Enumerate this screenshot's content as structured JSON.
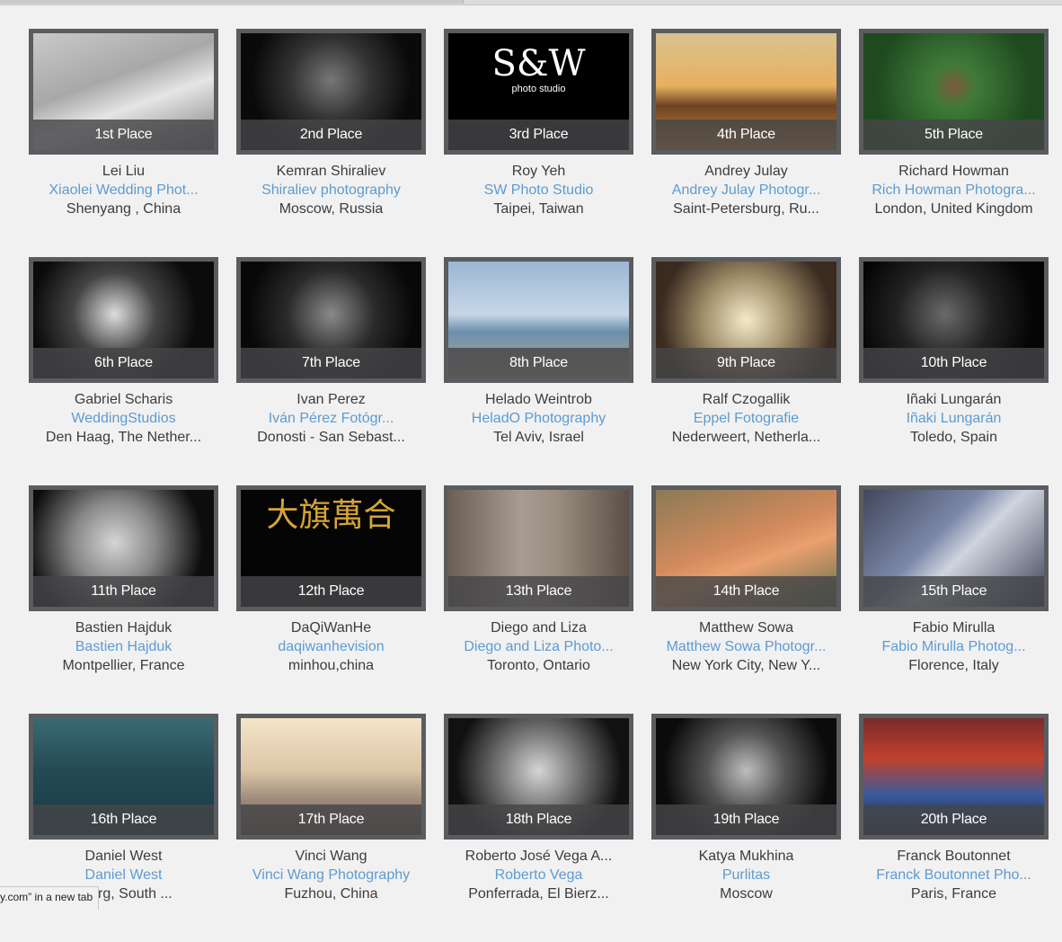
{
  "colors": {
    "link": "#5d9bd1",
    "text": "#3c3c3c",
    "background": "#f1f1f1",
    "frame": "#5a5c60"
  },
  "logos": {
    "third_place_logo": {
      "main": "S&W",
      "sub": "photo studio"
    },
    "twelfth_place_logo": {
      "text": "大旗萬合"
    }
  },
  "status_tooltip": "y.com” in a new tab",
  "entries": [
    {
      "place": "1st Place",
      "name": "Lei Liu",
      "studio": "Xiaolei Wedding Phot...",
      "location": "Shenyang , China"
    },
    {
      "place": "2nd Place",
      "name": "Kemran Shiraliev",
      "studio": "Shiraliev photography",
      "location": "Moscow, Russia"
    },
    {
      "place": "3rd Place",
      "name": "Roy Yeh",
      "studio": "SW Photo Studio",
      "location": "Taipei, Taiwan"
    },
    {
      "place": "4th Place",
      "name": "Andrey Julay",
      "studio": "Andrey Julay Photogr...",
      "location": "Saint-Petersburg, Ru..."
    },
    {
      "place": "5th Place",
      "name": "Richard Howman",
      "studio": "Rich Howman Photogra...",
      "location": "London, United Kingdom"
    },
    {
      "place": "6th Place",
      "name": "Gabriel Scharis",
      "studio": "WeddingStudios",
      "location": "Den Haag, The Nether..."
    },
    {
      "place": "7th Place",
      "name": "Ivan Perez",
      "studio": "Iván Pérez Fotógr...",
      "location": "Donosti - San Sebast..."
    },
    {
      "place": "8th Place",
      "name": "Helado Weintrob",
      "studio": "HeladO Photography",
      "location": "Tel Aviv, Israel"
    },
    {
      "place": "9th Place",
      "name": "Ralf Czogallik",
      "studio": "Eppel Fotografie",
      "location": "Nederweert, Netherla..."
    },
    {
      "place": "10th Place",
      "name": "Iñaki Lungarán",
      "studio": "Iñaki Lungarán",
      "location": "Toledo, Spain"
    },
    {
      "place": "11th Place",
      "name": "Bastien Hajduk",
      "studio": "Bastien Hajduk",
      "location": "Montpellier, France"
    },
    {
      "place": "12th Place",
      "name": "DaQiWanHe",
      "studio": "daqiwanhevision",
      "location": "minhou,china"
    },
    {
      "place": "13th Place",
      "name": "Diego and Liza",
      "studio": "Diego and Liza Photo...",
      "location": "Toronto, Ontario"
    },
    {
      "place": "14th Place",
      "name": "Matthew Sowa",
      "studio": "Matthew Sowa Photogr...",
      "location": "New York City, New Y..."
    },
    {
      "place": "15th Place",
      "name": "Fabio Mirulla",
      "studio": "Fabio Mirulla Photog...",
      "location": "Florence, Italy"
    },
    {
      "place": "16th Place",
      "name": "Daniel West",
      "studio": "Daniel West",
      "location": "sburg, South ..."
    },
    {
      "place": "17th Place",
      "name": "Vinci Wang",
      "studio": "Vinci Wang Photography",
      "location": "Fuzhou, China"
    },
    {
      "place": "18th Place",
      "name": "Roberto José Vega A...",
      "studio": "Roberto Vega",
      "location": "Ponferrada, El Bierz..."
    },
    {
      "place": "19th Place",
      "name": "Katya Mukhina",
      "studio": "Purlitas",
      "location": "Moscow"
    },
    {
      "place": "20th Place",
      "name": "Franck Boutonnet",
      "studio": "Franck Boutonnet Pho...",
      "location": "Paris, France"
    }
  ]
}
